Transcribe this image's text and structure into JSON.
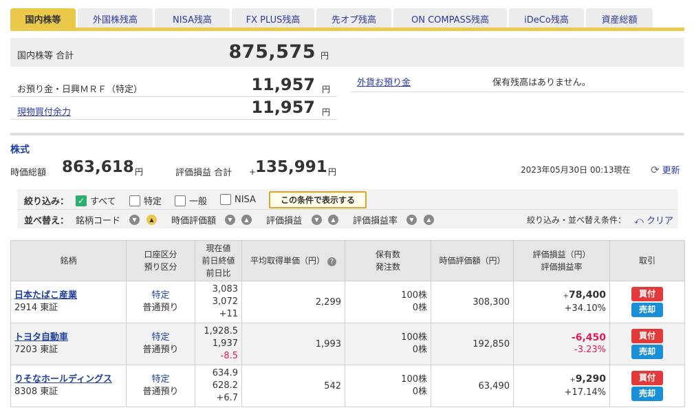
{
  "tabs": [
    "国内株等",
    "外国株残高",
    "NISA残高",
    "FX PLUS残高",
    "先オプ残高",
    "ON COMPASS残高",
    "iDeCo残高",
    "資産総額"
  ],
  "summary": {
    "total_label": "国内株等 合計",
    "total_value": "875,575",
    "yen": "円",
    "deposit_label": "お預り金・日興ＭＲＦ（特定）",
    "deposit_value": "11,957",
    "buying_power_label": "現物買付余力",
    "buying_power_value": "11,957",
    "fx_label": "外貨お預り金",
    "fx_message": "保有残高はありません。"
  },
  "stocks": {
    "title": "株式",
    "market_value_label": "時価総額",
    "market_value": "863,618",
    "pl_label": "評価損益 合計",
    "pl_sign": "+",
    "pl_value": "135,991",
    "timestamp": "2023年05月30日 00:13現在",
    "refresh_label": "更新"
  },
  "filter": {
    "label": "絞り込み：",
    "options": [
      "すべて",
      "特定",
      "一般",
      "NISA"
    ],
    "apply_label": "この条件で表示する",
    "sort_label": "並べ替え：",
    "sort_items": [
      "銘柄コード",
      "時価評価額",
      "評価損益",
      "評価損益率"
    ],
    "conditions_label": "絞り込み・並べ替え条件：",
    "clear_label": "クリア"
  },
  "table": {
    "headers": {
      "name": "銘柄",
      "account_1": "口座区分",
      "account_2": "預り区分",
      "price_1": "現在値",
      "price_2": "前日終値",
      "price_3": "前日比",
      "avg_cost": "平均取得単価（円）",
      "qty_1": "保有数",
      "qty_2": "発注数",
      "valuation": "時価評価額（円）",
      "pl_1": "評価損益（円）",
      "pl_2": "評価損益率",
      "trade": "取引"
    },
    "rows": [
      {
        "name": "日本たばこ産業",
        "code": "2914 東証",
        "account": "特定",
        "custody": "普通預り",
        "price": "3,083",
        "prev_close": "3,072",
        "change": "+11",
        "avg_cost": "2,299",
        "held": "100株",
        "ordered": "0株",
        "valuation": "308,300",
        "pl_sign": "+",
        "pl": "78,400",
        "pl_rate": "+34.10%"
      },
      {
        "name": "トヨタ自動車",
        "code": "7203 東証",
        "account": "特定",
        "custody": "普通預り",
        "price": "1,928.5",
        "prev_close": "1,937",
        "change": "-8.5",
        "avg_cost": "1,993",
        "held": "100株",
        "ordered": "0株",
        "valuation": "192,850",
        "pl_sign": "",
        "pl": "-6,450",
        "pl_rate": "-3.23%"
      },
      {
        "name": "りそなホールディングス",
        "code": "8308 東証",
        "account": "特定",
        "custody": "普通預り",
        "price": "634.9",
        "prev_close": "628.2",
        "change": "+6.7",
        "avg_cost": "542",
        "held": "100株",
        "ordered": "0株",
        "valuation": "63,490",
        "pl_sign": "+",
        "pl": "9,290",
        "pl_rate": "+17.14%"
      }
    ],
    "buy_label": "買付",
    "sell_label": "売却"
  },
  "colors": {
    "accent_gold": "#e9c84a",
    "link_blue": "#2a3a9e",
    "loss_red": "#e01a52",
    "buy_red": "#e23a3a",
    "sell_blue": "#1b8fd6"
  }
}
